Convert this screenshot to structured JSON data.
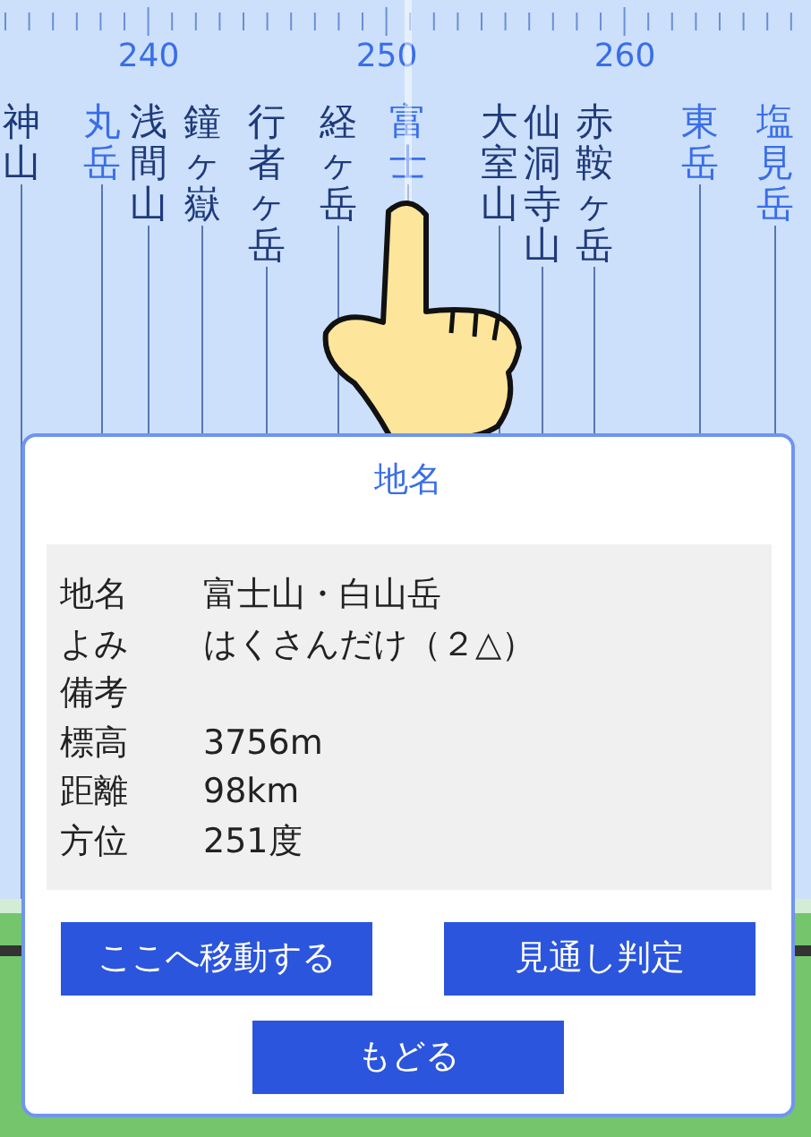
{
  "scale": {
    "labels": [
      "240",
      "250",
      "260"
    ]
  },
  "peaks": [
    {
      "name": "神山",
      "color": "#1f3a7a"
    },
    {
      "name": "丸岳",
      "color": "#3a6ee8"
    },
    {
      "name": "浅間山",
      "color": "#1f3a7a"
    },
    {
      "name": "鐘ヶ嶽",
      "color": "#1f3a7a"
    },
    {
      "name": "行者ヶ岳",
      "color": "#1f3a7a"
    },
    {
      "name": "経ヶ岳",
      "color": "#1f3a7a"
    },
    {
      "name": "富士",
      "color": "#3a6ee8"
    },
    {
      "name": "大室山",
      "color": "#1f3a7a"
    },
    {
      "name": "仙洞寺山",
      "color": "#1f3a7a"
    },
    {
      "name": "赤鞍ヶ岳",
      "color": "#1f3a7a"
    },
    {
      "name": "東岳",
      "color": "#3a6ee8"
    },
    {
      "name": "塩見岳",
      "color": "#3a6ee8"
    }
  ],
  "dialog": {
    "title": "地名",
    "rows": [
      {
        "label": "地名",
        "value": "富士山・白山岳"
      },
      {
        "label": "よみ",
        "value": "はくさんだけ（２△）"
      },
      {
        "label": "備考"
      },
      {
        "label": "標高",
        "value": "3756m"
      },
      {
        "label": "距離",
        "value": "98km"
      },
      {
        "label": "方位",
        "value": "251度"
      }
    ],
    "buttons": [
      "ここへ移動する",
      "見通し判定"
    ],
    "back_button": "もどる"
  }
}
